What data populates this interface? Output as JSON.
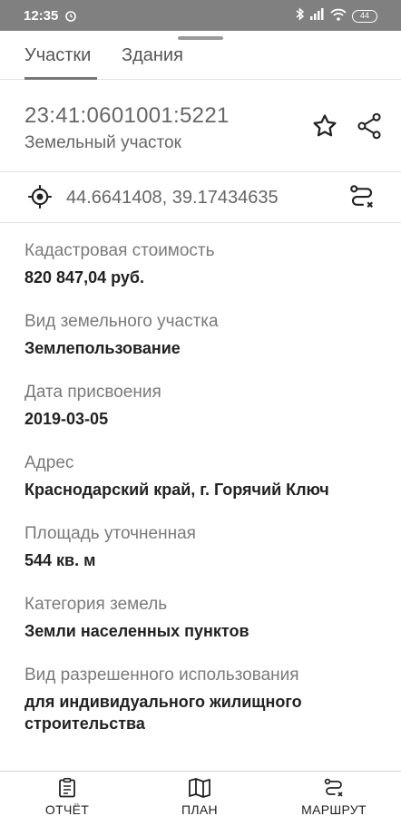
{
  "status_bar": {
    "time": "12:35",
    "battery": "44"
  },
  "tabs": [
    {
      "label": "Участки",
      "active": true
    },
    {
      "label": "Здания",
      "active": false
    }
  ],
  "parcel": {
    "cadastral_number": "23:41:0601001:5221",
    "object_type": "Земельный участок",
    "coordinates": "44.6641408, 39.17434635"
  },
  "fields": [
    {
      "label": "Кадастровая стоимость",
      "value": "820 847,04 руб."
    },
    {
      "label": "Вид земельного участка",
      "value": "Землепользование"
    },
    {
      "label": "Дата присвоения",
      "value": "2019-03-05"
    },
    {
      "label": "Адрес",
      "value": "Краснодарский край, г. Горячий Ключ"
    },
    {
      "label": "Площадь уточненная",
      "value": "544 кв. м"
    },
    {
      "label": "Категория земель",
      "value": "Земли населенных пунктов"
    },
    {
      "label": "Вид разрешенного использования",
      "value": "для индивидуального жилищного строительства"
    }
  ],
  "bottom_nav": {
    "report": "ОТЧЁТ",
    "plan": "ПЛАН",
    "route": "МАРШРУТ"
  },
  "icons": [
    "alarm-icon",
    "bluetooth-icon",
    "signal-icon",
    "wifi-icon",
    "battery-icon",
    "star-icon",
    "share-icon",
    "gps-icon",
    "route-icon",
    "report-icon",
    "map-icon"
  ]
}
